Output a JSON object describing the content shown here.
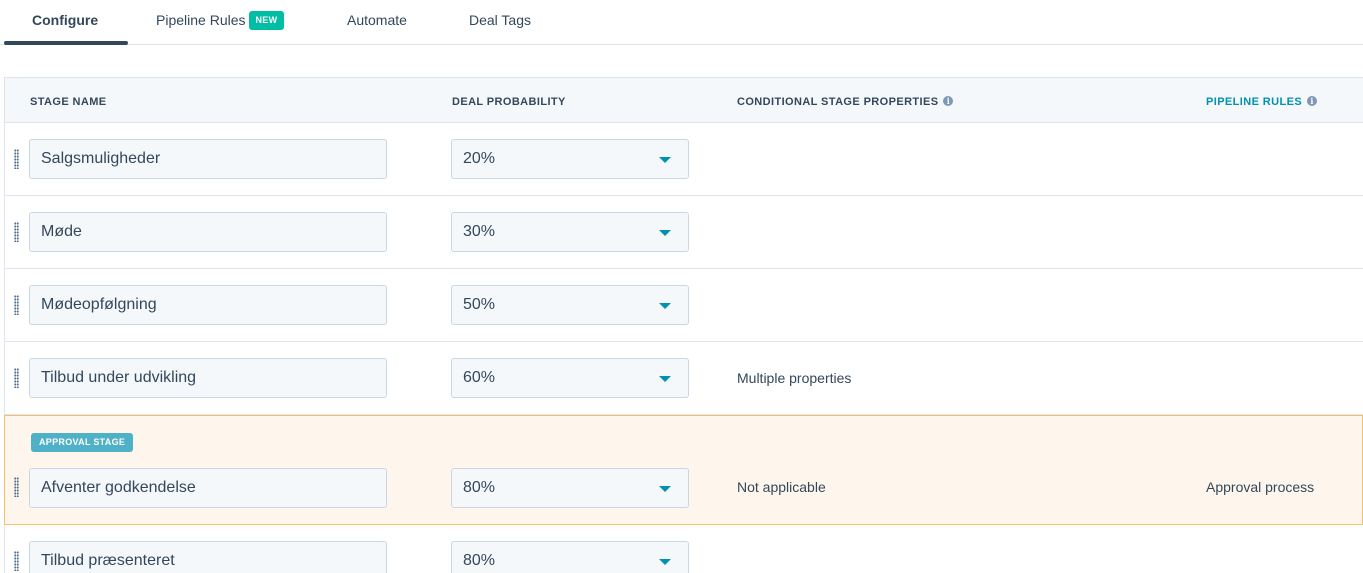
{
  "tabs": [
    {
      "label": "Configure"
    },
    {
      "label": "Pipeline Rules",
      "badge": "NEW"
    },
    {
      "label": "Automate"
    },
    {
      "label": "Deal Tags"
    }
  ],
  "table": {
    "headers": {
      "stage_name": "STAGE NAME",
      "deal_probability": "DEAL PROBABILITY",
      "conditional_stage_properties": "CONDITIONAL STAGE PROPERTIES",
      "pipeline_rules": "PIPELINE RULES"
    },
    "rows": [
      {
        "stage": "Salgsmuligheder",
        "probability": "20%",
        "conditional": "",
        "rule": ""
      },
      {
        "stage": "Møde",
        "probability": "30%",
        "conditional": "",
        "rule": ""
      },
      {
        "stage": "Mødeopfølgning",
        "probability": "50%",
        "conditional": "",
        "rule": ""
      },
      {
        "stage": "Tilbud under udvikling",
        "probability": "60%",
        "conditional": "Multiple properties",
        "rule": ""
      },
      {
        "stage": "Afventer godkendelse",
        "probability": "80%",
        "conditional": "Not applicable",
        "rule": "Approval process",
        "badge": "APPROVAL STAGE"
      },
      {
        "stage": "Tilbud præsenteret",
        "probability": "80%",
        "conditional": "",
        "rule": ""
      }
    ]
  },
  "icons": {
    "info": "info-icon",
    "drag": "drag-handle-icon",
    "caret": "chevron-down-icon"
  },
  "colors": {
    "accent": "#0091ae",
    "new_badge": "#00bda5",
    "approval_badge": "#4fb1c7",
    "approval_row_bg": "#fef6ec",
    "approval_row_border": "#f5c26b"
  }
}
